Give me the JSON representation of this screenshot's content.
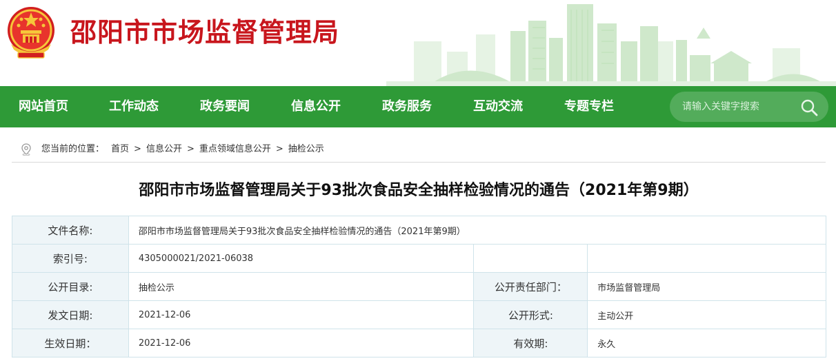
{
  "header": {
    "site_title": "邵阳市市场监督管理局"
  },
  "nav": {
    "items": [
      {
        "label": "网站首页"
      },
      {
        "label": "工作动态"
      },
      {
        "label": "政务要闻"
      },
      {
        "label": "信息公开"
      },
      {
        "label": "政务服务"
      },
      {
        "label": "互动交流"
      },
      {
        "label": "专题专栏"
      }
    ],
    "search_placeholder": "请输入关键字搜索"
  },
  "breadcrumb": {
    "prefix": "您当前的位置：",
    "items": [
      "首页",
      "信息公开",
      "重点领域信息公开",
      "抽检公示"
    ],
    "separator": ">"
  },
  "article": {
    "title": "邵阳市市场监督管理局关于93批次食品安全抽样检验情况的通告（2021年第9期）"
  },
  "info": {
    "doc_name_label": "文件名称:",
    "doc_name": "邵阳市市场监督管理局关于93批次食品安全抽样检验情况的通告（2021年第9期）",
    "index_label": "索引号:",
    "index": "4305000021/2021-06038",
    "catalog_label": "公开目录:",
    "catalog": "抽检公示",
    "dept_label": "公开责任部门：",
    "dept": "市场监督管理局",
    "issue_date_label": "发文日期:",
    "issue_date": "2021-12-06",
    "form_label": "公开形式:",
    "form": "主动公开",
    "effective_date_label": "生效日期：",
    "effective_date": "2021-12-06",
    "validity_label": "有效期:",
    "validity": "永久"
  },
  "colors": {
    "brand_red": "#c8161d",
    "nav_green": "#2e9a37",
    "table_label_bg": "#eef5f8",
    "table_border": "#cfe3ea"
  },
  "icons": [
    "national-emblem-icon",
    "search-icon",
    "location-icon"
  ]
}
